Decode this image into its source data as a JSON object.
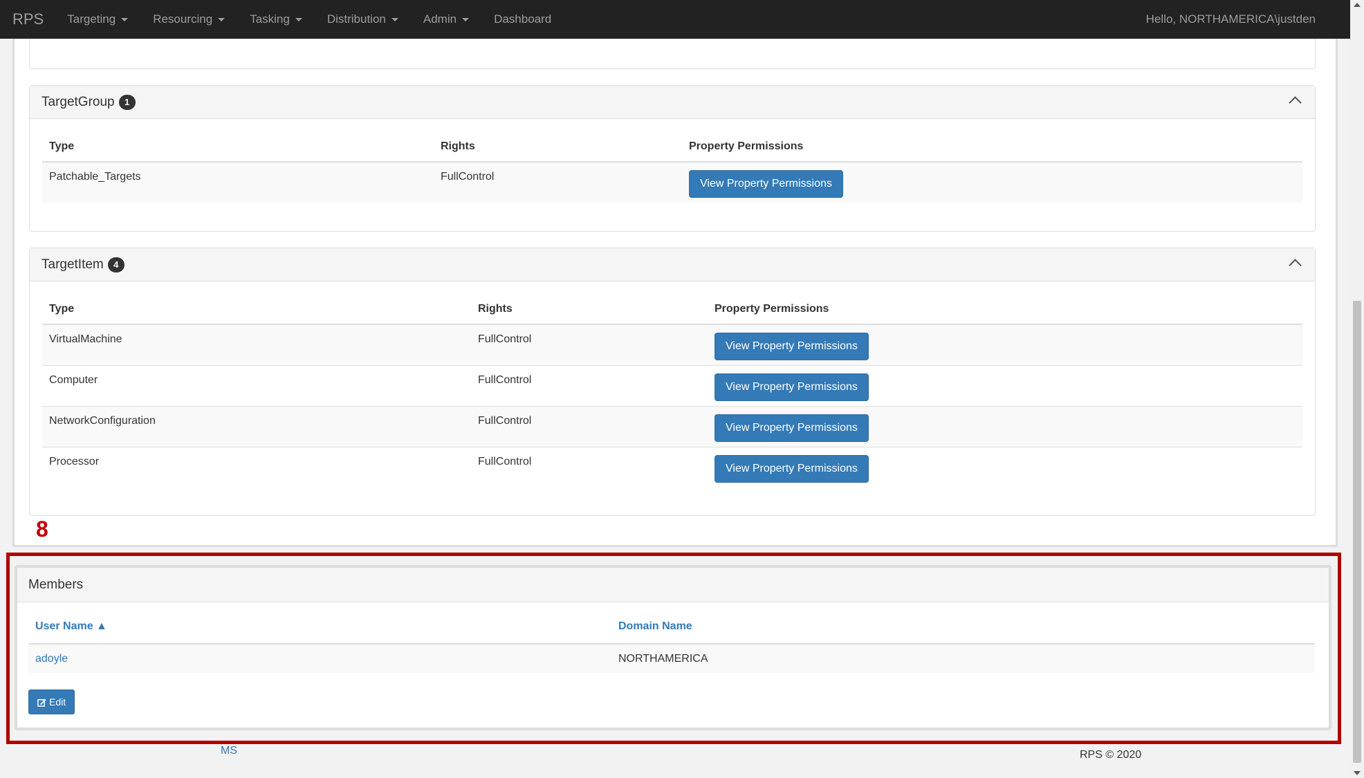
{
  "navbar": {
    "brand": "RPS",
    "items": [
      {
        "label": "Targeting",
        "dropdown": true
      },
      {
        "label": "Resourcing",
        "dropdown": true
      },
      {
        "label": "Tasking",
        "dropdown": true
      },
      {
        "label": "Distribution",
        "dropdown": true
      },
      {
        "label": "Admin",
        "dropdown": true
      },
      {
        "label": "Dashboard",
        "dropdown": false
      }
    ],
    "user_greeting": "Hello, NORTHAMERICA\\justden"
  },
  "target_group": {
    "title": "TargetGroup",
    "count": "1",
    "columns": [
      "Type",
      "Rights",
      "Property Permissions"
    ],
    "rows": [
      {
        "type": "Patchable_Targets",
        "rights": "FullControl",
        "button": "View Property Permissions"
      }
    ]
  },
  "target_item": {
    "title": "TargetItem",
    "count": "4",
    "columns": [
      "Type",
      "Rights",
      "Property Permissions"
    ],
    "rows": [
      {
        "type": "VirtualMachine",
        "rights": "FullControl",
        "button": "View Property Permissions"
      },
      {
        "type": "Computer",
        "rights": "FullControl",
        "button": "View Property Permissions"
      },
      {
        "type": "NetworkConfiguration",
        "rights": "FullControl",
        "button": "View Property Permissions"
      },
      {
        "type": "Processor",
        "rights": "FullControl",
        "button": "View Property Permissions"
      }
    ]
  },
  "annotation": {
    "number": "8",
    "color": "#b00000"
  },
  "members": {
    "title": "Members",
    "columns": [
      "User Name ▲",
      "Domain Name"
    ],
    "rows": [
      {
        "user": "adoyle",
        "domain": "NORTHAMERICA"
      }
    ],
    "edit_label": "Edit"
  },
  "footer": {
    "ms": "MS",
    "copyright": "RPS © 2020"
  },
  "colors": {
    "navbar_bg": "#222222",
    "primary": "#337ab7",
    "annotation": "#b00000"
  },
  "icons": {
    "caret": "caret-down-icon",
    "chevron": "chevron-up-icon",
    "edit": "edit-icon"
  }
}
